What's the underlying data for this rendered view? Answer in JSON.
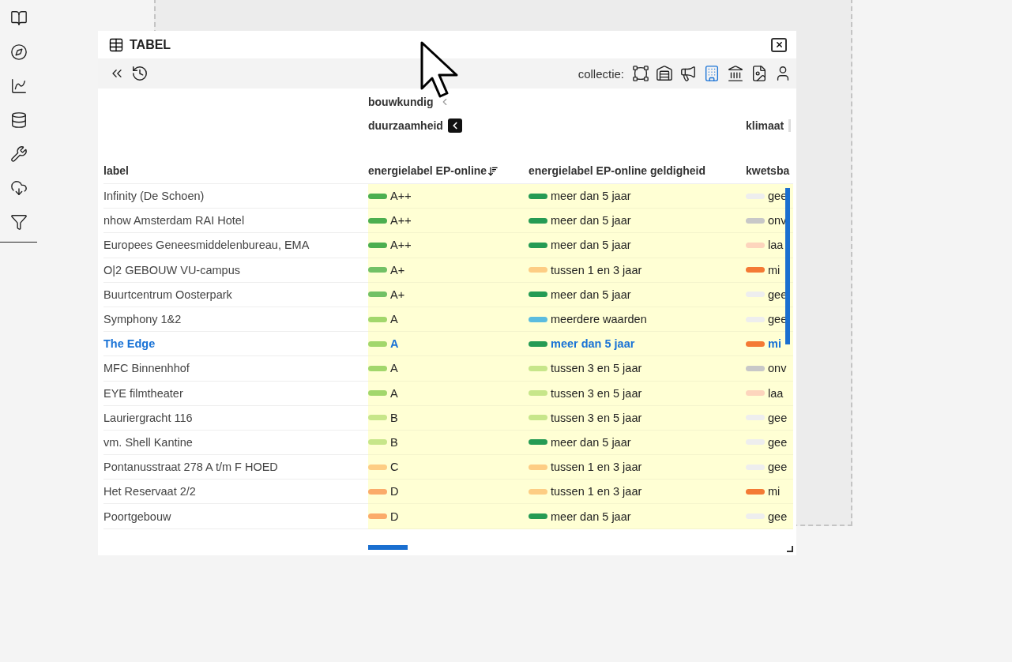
{
  "panel": {
    "title": "TABEL"
  },
  "toolbar": {
    "collection_label": "collectie:",
    "collections": [
      {
        "kind": "shape",
        "selected": false
      },
      {
        "kind": "warehouse",
        "selected": false
      },
      {
        "kind": "megaphone",
        "selected": false
      },
      {
        "kind": "building",
        "selected": true
      },
      {
        "kind": "landmark",
        "selected": false
      },
      {
        "kind": "file",
        "selected": false
      },
      {
        "kind": "user",
        "selected": false
      }
    ]
  },
  "table": {
    "group": "bouwkundig",
    "subgroups": [
      "duurzaamheid",
      "klimaat"
    ],
    "label_column": "label",
    "columns": [
      "energielabel EP-online",
      "energielabel EP-online geldigheid",
      "kwetsba"
    ],
    "rows": [
      {
        "label": "Infinity (De Schoen)",
        "selected": false,
        "cells": [
          {
            "text": "A++",
            "color": "#4caf50"
          },
          {
            "text": "meer dan 5 jaar",
            "color": "#259b54"
          },
          {
            "text": "gee",
            "color": "#eeeeee"
          }
        ]
      },
      {
        "label": "nhow Amsterdam RAI Hotel",
        "selected": false,
        "cells": [
          {
            "text": "A++",
            "color": "#4caf50"
          },
          {
            "text": "meer dan 5 jaar",
            "color": "#259b54"
          },
          {
            "text": "onv",
            "color": "#c8c8c8"
          }
        ]
      },
      {
        "label": "Europees Geneesmiddelenbureau, EMA",
        "selected": false,
        "cells": [
          {
            "text": "A++",
            "color": "#4caf50"
          },
          {
            "text": "meer dan 5 jaar",
            "color": "#259b54"
          },
          {
            "text": "laa",
            "color": "#fdd5bd"
          }
        ]
      },
      {
        "label": "O|2 GEBOUW VU-campus",
        "selected": false,
        "cells": [
          {
            "text": "A+",
            "color": "#72c166"
          },
          {
            "text": "tussen 1 en 3 jaar",
            "color": "#fdcd84"
          },
          {
            "text": "mi",
            "color": "#f47a35"
          }
        ]
      },
      {
        "label": "Buurtcentrum Oosterpark",
        "selected": false,
        "cells": [
          {
            "text": "A+",
            "color": "#72c166"
          },
          {
            "text": "meer dan 5 jaar",
            "color": "#259b54"
          },
          {
            "text": "gee",
            "color": "#eeeeee"
          }
        ]
      },
      {
        "label": "Symphony 1&2",
        "selected": false,
        "cells": [
          {
            "text": "A",
            "color": "#a2d76c"
          },
          {
            "text": "meerdere waarden",
            "color": "#5bbcdf"
          },
          {
            "text": "gee",
            "color": "#eeeeee"
          }
        ]
      },
      {
        "label": "The Edge",
        "selected": true,
        "cells": [
          {
            "text": "A",
            "color": "#a2d76c"
          },
          {
            "text": "meer dan 5 jaar",
            "color": "#259b54"
          },
          {
            "text": "mi",
            "color": "#f47a35"
          }
        ]
      },
      {
        "label": "MFC Binnenhhof",
        "selected": false,
        "cells": [
          {
            "text": "A",
            "color": "#a2d76c"
          },
          {
            "text": "tussen 3 en 5 jaar",
            "color": "#c7e68a"
          },
          {
            "text": "onv",
            "color": "#c8c8c8"
          }
        ]
      },
      {
        "label": "EYE filmtheater",
        "selected": false,
        "cells": [
          {
            "text": "A",
            "color": "#a2d76c"
          },
          {
            "text": "tussen 3 en 5 jaar",
            "color": "#c7e68a"
          },
          {
            "text": "laa",
            "color": "#fdd5bd"
          }
        ]
      },
      {
        "label": "Lauriergracht 116",
        "selected": false,
        "cells": [
          {
            "text": "B",
            "color": "#c7e68a"
          },
          {
            "text": "tussen 3 en 5 jaar",
            "color": "#c7e68a"
          },
          {
            "text": "gee",
            "color": "#eeeeee"
          }
        ]
      },
      {
        "label": "vm. Shell Kantine",
        "selected": false,
        "cells": [
          {
            "text": "B",
            "color": "#c7e68a"
          },
          {
            "text": "meer dan 5 jaar",
            "color": "#259b54"
          },
          {
            "text": "gee",
            "color": "#eeeeee"
          }
        ]
      },
      {
        "label": "Pontanusstraat 278 A t/m F HOED",
        "selected": false,
        "cells": [
          {
            "text": "C",
            "color": "#fdcd84"
          },
          {
            "text": "tussen 1 en 3 jaar",
            "color": "#fdcd84"
          },
          {
            "text": "gee",
            "color": "#eeeeee"
          }
        ]
      },
      {
        "label": "Het Reservaat 2/2",
        "selected": false,
        "cells": [
          {
            "text": "D",
            "color": "#fbab6a"
          },
          {
            "text": "tussen 1 en 3 jaar",
            "color": "#fdcd84"
          },
          {
            "text": "mi",
            "color": "#f47a35"
          }
        ]
      },
      {
        "label": "Poortgebouw",
        "selected": false,
        "cells": [
          {
            "text": "D",
            "color": "#fbab6a"
          },
          {
            "text": "meer dan 5 jaar",
            "color": "#259b54"
          },
          {
            "text": "gee",
            "color": "#eeeeee"
          }
        ]
      }
    ]
  }
}
